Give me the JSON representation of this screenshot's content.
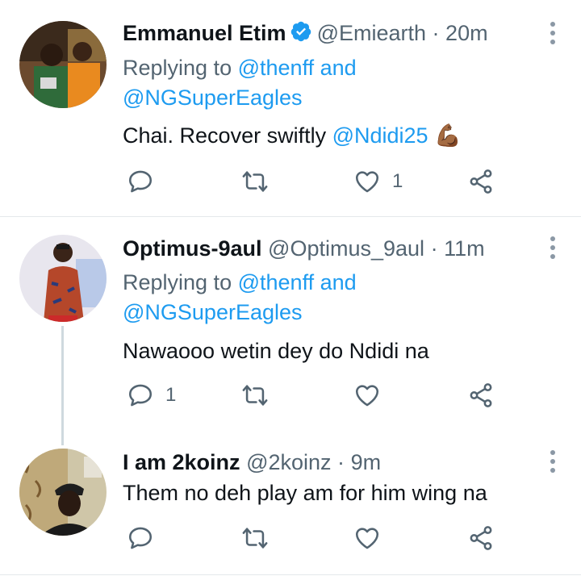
{
  "tweets": [
    {
      "name": "Emmanuel Etim",
      "verified": true,
      "handle": "@Emiearth",
      "separator": "·",
      "time": "20m",
      "replying_prefix": "Replying to",
      "replying_to_1": "@thenff",
      "replying_and": "and",
      "replying_to_2": "@NGSuperEagles",
      "text_plain": "Chai. Recover swiftly",
      "text_mention": "@Ndidi25",
      "emoji": "💪🏾",
      "reply_count": "",
      "retweet_count": "",
      "like_count": "1"
    },
    {
      "name": "Optimus-9aul",
      "handle": "@Optimus_9aul",
      "separator": "·",
      "time": "11m",
      "replying_prefix": "Replying to",
      "replying_to_1": "@thenff",
      "replying_and": "and",
      "replying_to_2": "@NGSuperEagles",
      "text": "Nawaooo wetin dey do Ndidi na",
      "reply_count": "1",
      "retweet_count": "",
      "like_count": ""
    },
    {
      "name": "I am 2koinz",
      "handle": "@2koinz",
      "separator": "·",
      "time": "9m",
      "text": "Them no deh play am for him wing na",
      "reply_count": "",
      "retweet_count": "",
      "like_count": ""
    }
  ],
  "colors": {
    "link": "#1d9bf0",
    "muted": "#536471",
    "verified": "#1d9bf0",
    "divider": "#e4e8eb"
  },
  "icons": [
    "reply-icon",
    "retweet-icon",
    "like-icon",
    "share-icon",
    "more-icon",
    "verified-icon"
  ]
}
